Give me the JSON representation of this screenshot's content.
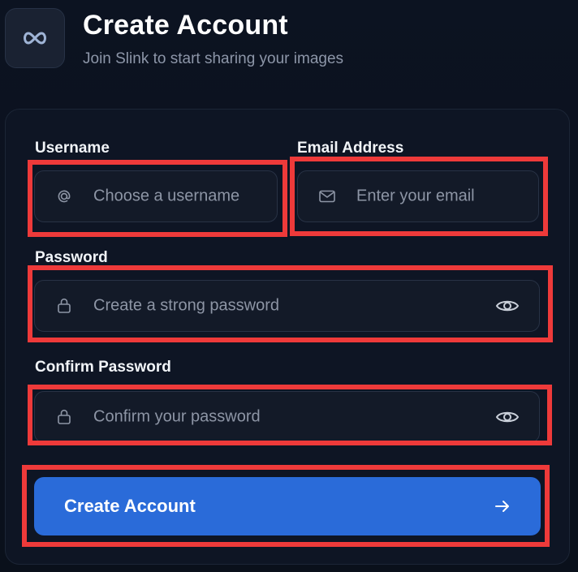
{
  "header": {
    "logo_icon": "infinity-icon",
    "title": "Create Account",
    "subtitle": "Join Slink to start sharing your images"
  },
  "form": {
    "username": {
      "label": "Username",
      "placeholder": "Choose a username",
      "icon": "at-icon"
    },
    "email": {
      "label": "Email Address",
      "placeholder": "Enter your email",
      "icon": "mail-icon"
    },
    "password": {
      "label": "Password",
      "placeholder": "Create a strong password",
      "icon": "lock-icon",
      "toggle_icon": "eye-icon"
    },
    "confirm_password": {
      "label": "Confirm Password",
      "placeholder": "Confirm your password",
      "icon": "lock-icon",
      "toggle_icon": "eye-icon"
    },
    "submit": {
      "label": "Create Account",
      "icon": "arrow-right-icon"
    }
  },
  "colors": {
    "background": "#0b1220",
    "card": "#0e1524",
    "input_bg": "#131a28",
    "primary_button": "#2a6bd9",
    "highlight": "#ee3a3a"
  }
}
